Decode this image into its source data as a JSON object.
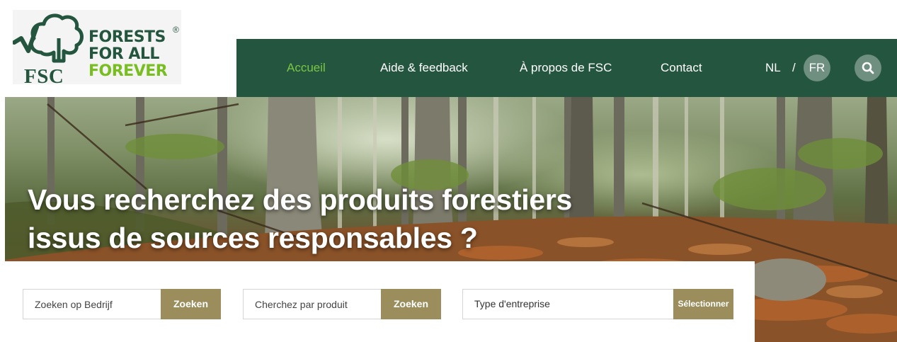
{
  "logo": {
    "line1": "FORESTS",
    "line2": "FOR ALL",
    "line3": "FOREVER",
    "registered": "®",
    "acronym": "FSC"
  },
  "nav": {
    "items": [
      {
        "label": "Accueil",
        "active": true
      },
      {
        "label": "Aide & feedback",
        "active": false
      },
      {
        "label": "À propos de FSC",
        "active": false
      },
      {
        "label": "Contact",
        "active": false
      }
    ],
    "lang_nl": "NL",
    "lang_sep": "/",
    "lang_fr": "FR",
    "search_icon": "search-icon"
  },
  "hero": {
    "title_line1": "Vous recherchez des produits forestiers",
    "title_line2": "issus de sources responsables ?"
  },
  "search": {
    "company": {
      "placeholder": "Zoeken op Bedrijf",
      "button": "Zoeken"
    },
    "product": {
      "placeholder": "Cherchez par produit",
      "button": "Zoeken"
    },
    "type": {
      "value": "Type d'entreprise",
      "button": "Sélectionner"
    }
  },
  "colors": {
    "nav_bg": "#24563f",
    "active_link": "#7cc544",
    "button_gold": "#9c8e5c",
    "logo_green_light": "#78be20",
    "logo_green_dark": "#24563f"
  }
}
